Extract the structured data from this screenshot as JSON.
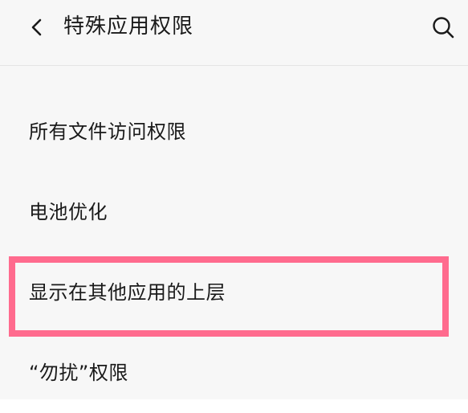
{
  "header": {
    "back_icon": "chevron-left-icon",
    "title": "特殊应用权限",
    "search_icon": "search-icon"
  },
  "list": {
    "items": [
      {
        "label": "所有文件访问权限"
      },
      {
        "label": "电池优化"
      },
      {
        "label": "显示在其他应用的上层"
      },
      {
        "label": "“勿扰”权限"
      }
    ]
  },
  "highlight": {
    "color": "#ff6b8e",
    "target": "显示在其他应用的上层"
  },
  "colors": {
    "background": "#f7f7f7",
    "text": "#1a1a1a"
  }
}
